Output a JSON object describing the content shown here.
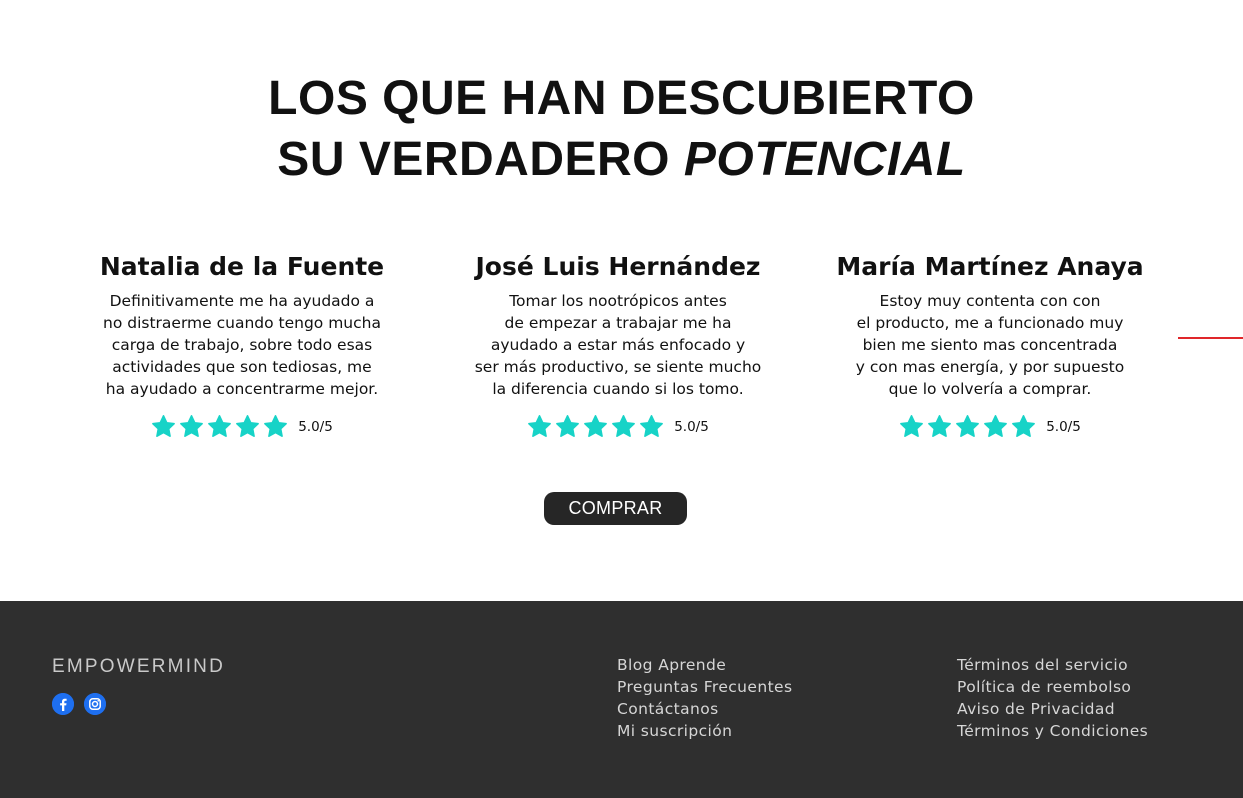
{
  "headline": {
    "line1": "LOS QUE HAN DESCUBIERTO",
    "line2_plain": "SU VERDADERO ",
    "line2_emphasis": "POTENCIAL"
  },
  "testimonials": [
    {
      "name": "Natalia de la Fuente",
      "quote_lines": [
        "Definitivamente me ha ayudado a",
        "no distraerme cuando tengo mucha",
        "carga de trabajo, sobre todo esas",
        "actividades que son tediosas, me",
        "ha ayudado a concentrarme mejor."
      ],
      "stars": 5,
      "score": "5.0/5"
    },
    {
      "name": "José Luis Hernández",
      "quote_lines": [
        "Tomar los nootrópicos antes",
        "de empezar a trabajar me ha",
        "ayudado a estar más enfocado y",
        "ser más productivo, se siente mucho",
        "la diferencia cuando si los tomo."
      ],
      "stars": 5,
      "score": "5.0/5"
    },
    {
      "name": "María Martínez Anaya",
      "quote_lines": [
        "Estoy muy contenta con con",
        "el producto, me a funcionado muy",
        "bien me siento mas concentrada",
        "y con mas energía, y por supuesto",
        "que lo volvería a comprar."
      ],
      "stars": 5,
      "score": "5.0/5"
    }
  ],
  "colors": {
    "star": "#17d3c7",
    "button_bg": "#262626",
    "footer_bg": "#2f2f2f",
    "accent_line": "#e0262a",
    "social": "#1e6ff0"
  },
  "cta": {
    "label": "COMPRAR"
  },
  "footer": {
    "brand": "EMPOWERMIND",
    "social_icons": [
      "facebook-icon",
      "instagram-icon"
    ],
    "links_col1": [
      "Blog Aprende",
      "Preguntas Frecuentes",
      "Contáctanos",
      "Mi suscripción"
    ],
    "links_col2": [
      "Términos del servicio",
      "Política de reembolso",
      "Aviso de Privacidad",
      "Términos y Condiciones"
    ]
  }
}
